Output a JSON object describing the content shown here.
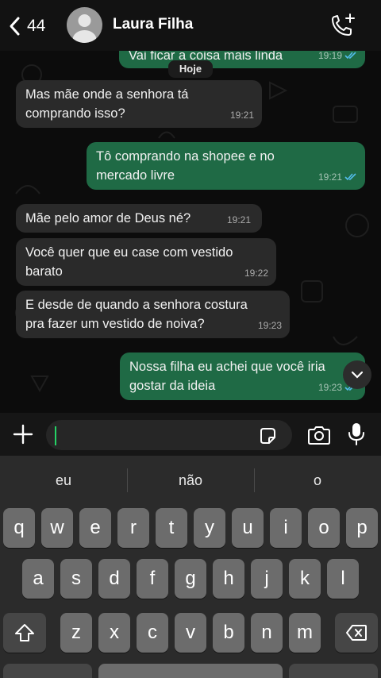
{
  "header": {
    "back_count": "44",
    "contact_name": "Laura Filha"
  },
  "chat": {
    "date_label": "Hoje",
    "messages": [
      {
        "dir": "out",
        "text": "Vai ficar a coisa mais linda",
        "time": "19:19"
      },
      {
        "dir": "in",
        "text": "Mas mãe onde a senhora tá comprando isso?",
        "time": "19:21"
      },
      {
        "dir": "out",
        "text": "Tô comprando na shopee e no mercado livre",
        "time": "19:21"
      },
      {
        "dir": "in",
        "text": "Mãe pelo amor de Deus né?",
        "time": "19:21"
      },
      {
        "dir": "in",
        "text": "Você quer que eu case com vestido barato",
        "time": "19:22"
      },
      {
        "dir": "in",
        "text": "E desde de quando a senhora costura pra fazer um vestido de noiva?",
        "time": "19:23"
      },
      {
        "dir": "out",
        "text": "Nossa filha eu achei que você iria gostar da ideia",
        "time": "19:23"
      }
    ]
  },
  "input": {
    "placeholder": ""
  },
  "keyboard": {
    "suggestions": [
      "eu",
      "não",
      "o"
    ],
    "row1": [
      "q",
      "w",
      "e",
      "r",
      "t",
      "y",
      "u",
      "i",
      "o",
      "p"
    ],
    "row2": [
      "a",
      "s",
      "d",
      "f",
      "g",
      "h",
      "j",
      "k",
      "l"
    ],
    "row3": [
      "z",
      "x",
      "c",
      "v",
      "b",
      "n",
      "m"
    ]
  },
  "colors": {
    "outgoing_bubble": "#1f6a45",
    "incoming_bubble": "#2a2a2a",
    "read_ticks": "#53bdeb"
  }
}
